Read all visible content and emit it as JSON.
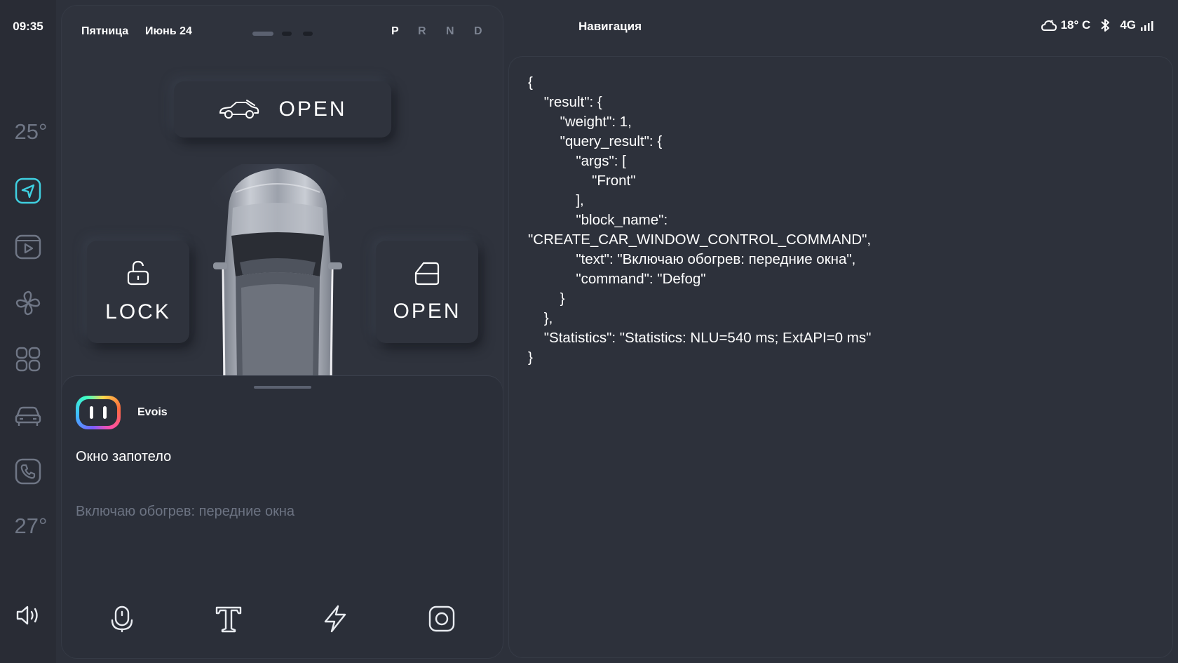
{
  "status_bar": {
    "time": "09:35",
    "day": "Пятница",
    "date": "Июнь 24",
    "gears": [
      "P",
      "R",
      "N",
      "D"
    ],
    "active_gear": "P",
    "nav_title": "Навигация",
    "weather": "18° C",
    "network": "4G"
  },
  "rail": {
    "temp_driver": "25°",
    "temp_passenger": "27°",
    "items": [
      {
        "icon": "navigation-icon",
        "active": true
      },
      {
        "icon": "media-play-icon",
        "active": false
      },
      {
        "icon": "fan-icon",
        "active": false
      },
      {
        "icon": "apps-grid-icon",
        "active": false
      },
      {
        "icon": "car-icon",
        "active": false
      },
      {
        "icon": "phone-icon",
        "active": false
      }
    ],
    "volume_icon": "volume-icon"
  },
  "car_controls": {
    "trunk_label": "OPEN",
    "lock_label": "LOCK",
    "door_label": "OPEN"
  },
  "assistant": {
    "name": "Evois",
    "user_utterance": "Окно запотело",
    "reply": "Включаю обогрев: передние окна",
    "tools": [
      "microphone-icon",
      "text-input-icon",
      "lightning-icon",
      "camera-icon"
    ]
  },
  "json_output": "{\n    \"result\": {\n        \"weight\": 1,\n        \"query_result\": {\n            \"args\": [\n                \"Front\"\n            ],\n            \"block_name\":\n\"CREATE_CAR_WINDOW_CONTROL_COMMAND\",\n            \"text\": \"Включаю обогрев: передние окна\",\n            \"command\": \"Defog\"\n        }\n    },\n    \"Statistics\": \"Statistics: NLU=540 ms; ExtAPI=0 ms\"\n}",
  "colors": {
    "background": "#2d313b",
    "accent": "#3fd0e0",
    "muted": "#6f7685"
  }
}
